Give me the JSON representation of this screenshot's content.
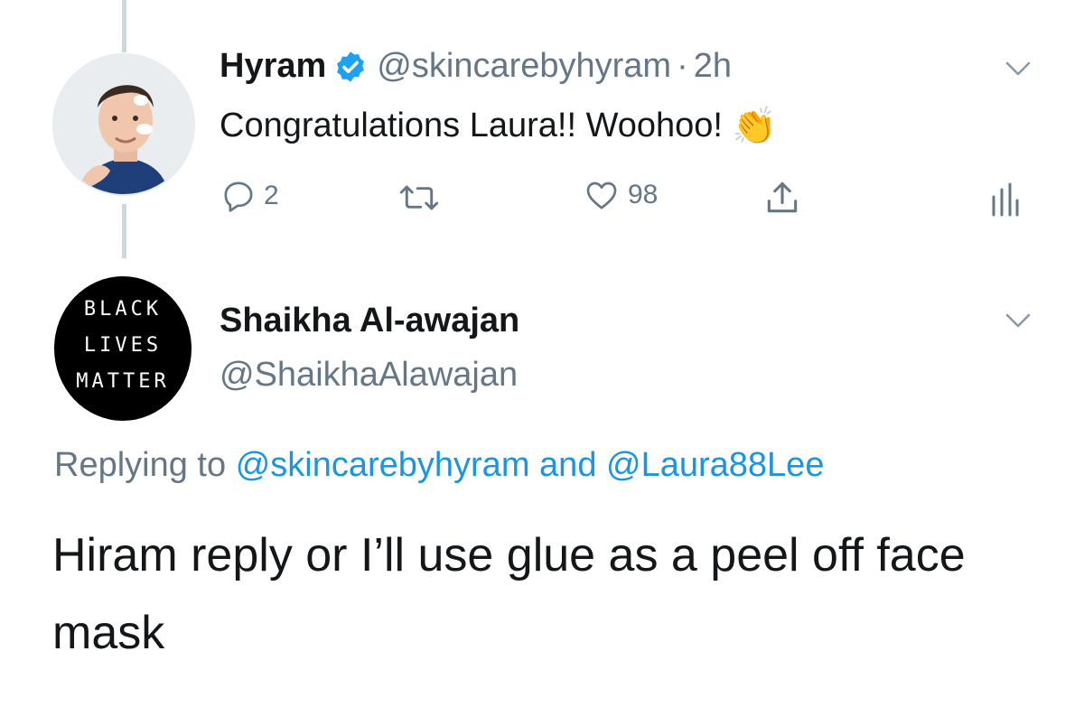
{
  "tweet1": {
    "display_name": "Hyram",
    "handle": "@skincarebyhyram",
    "separator": "·",
    "time": "2h",
    "text": "Congratulations Laura!! Woohoo!",
    "emoji": "👏",
    "actions": {
      "reply_count": "2",
      "like_count": "98"
    },
    "icons": [
      "verified-badge-icon",
      "chevron-down-icon",
      "reply-icon",
      "retweet-icon",
      "like-icon",
      "share-icon",
      "analytics-icon"
    ]
  },
  "tweet2": {
    "display_name": "Shaikha Al-awajan",
    "handle": "@ShaikhaAlawajan",
    "avatar_text": [
      "BLACK",
      "LIVES",
      "MATTER"
    ],
    "replying_prefix": "Replying to",
    "replying_mention_1": "@skincarebyhyram",
    "replying_and": "and",
    "replying_mention_2": "@Laura88Lee",
    "text": "Hiram reply or I’ll use glue as a peel off face mask"
  },
  "colors": {
    "text": "#14171a",
    "secondary": "#657786",
    "link": "#1b95e0",
    "verified": "#1da1f2",
    "thread_line": "#ccd6dd"
  }
}
